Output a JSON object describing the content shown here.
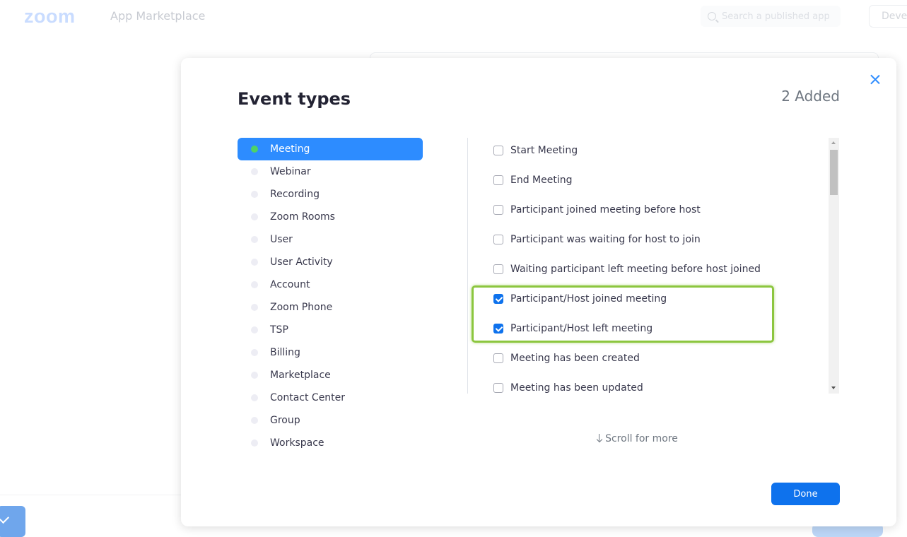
{
  "background": {
    "logo": "zoom",
    "title": "App Marketplace",
    "search_placeholder": "Search a published app",
    "dev_button": "Devel"
  },
  "modal": {
    "title": "Event types",
    "added": "2 Added",
    "categories": [
      {
        "label": "Meeting",
        "active": true
      },
      {
        "label": "Webinar",
        "active": false
      },
      {
        "label": "Recording",
        "active": false
      },
      {
        "label": "Zoom Rooms",
        "active": false
      },
      {
        "label": "User",
        "active": false
      },
      {
        "label": "User Activity",
        "active": false
      },
      {
        "label": "Account",
        "active": false
      },
      {
        "label": "Zoom Phone",
        "active": false
      },
      {
        "label": "TSP",
        "active": false
      },
      {
        "label": "Billing",
        "active": false
      },
      {
        "label": "Marketplace",
        "active": false
      },
      {
        "label": "Contact Center",
        "active": false
      },
      {
        "label": "Group",
        "active": false
      },
      {
        "label": "Workspace",
        "active": false
      }
    ],
    "events": [
      {
        "label": "Start Meeting",
        "checked": false
      },
      {
        "label": "End Meeting",
        "checked": false
      },
      {
        "label": "Participant joined meeting before host",
        "checked": false
      },
      {
        "label": "Participant was waiting for host to join",
        "checked": false
      },
      {
        "label": "Waiting participant left meeting before host joined",
        "checked": false
      },
      {
        "label": "Participant/Host joined meeting",
        "checked": true
      },
      {
        "label": "Participant/Host left meeting",
        "checked": true
      },
      {
        "label": "Meeting has been created",
        "checked": false
      },
      {
        "label": "Meeting has been updated",
        "checked": false
      }
    ],
    "scroll_hint": "Scroll for more",
    "done_label": "Done"
  },
  "colors": {
    "primary": "#0e72ed",
    "active_category": "#2d8cff",
    "active_dot": "#4ed266",
    "highlight": "#8cc63f"
  }
}
